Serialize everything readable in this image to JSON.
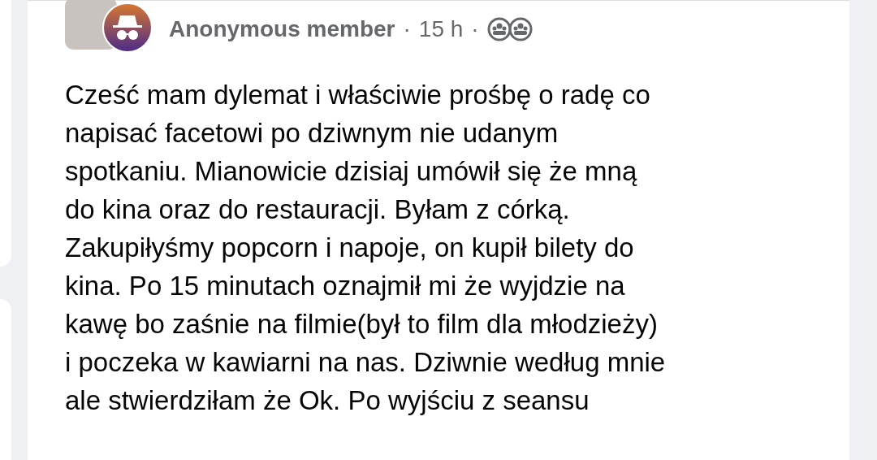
{
  "post": {
    "author": "Anonymous member",
    "separator_1": "·",
    "time": "15 h",
    "separator_2": "·",
    "body_lines": [
      "Cześć mam dylemat i właściwie prośbę o radę co",
      "napisać facetowi po dziwnym nie udanym",
      "spotkaniu. Mianowicie dzisiaj umówił się że mną",
      "do kina oraz do restauracji. Byłam z córką.",
      "Zakupiłyśmy popcorn i napoje, on kupił bilety do",
      "kina. Po 15 minutach oznajmił mi że wyjdzie na",
      "kawę bo zaśnie na filmie(był to film dla młodzieży)",
      "i poczeka w kawiarni na nas. Dziwnie według mnie",
      "ale stwierdziłam że Ok. Po wyjściu z seansu"
    ]
  }
}
